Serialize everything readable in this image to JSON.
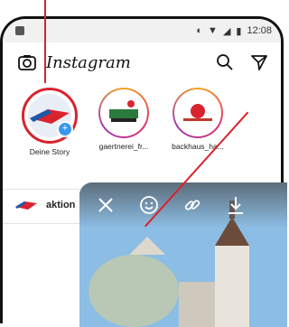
{
  "status_bar": {
    "time": "12:08"
  },
  "header": {
    "title": "Instagram"
  },
  "stories": [
    {
      "label": "Deine Story"
    },
    {
      "label": "gaertnerei_fr..."
    },
    {
      "label": "backhaus_ha..."
    }
  ],
  "feed": {
    "post_account": "aktion"
  },
  "colors": {
    "annotation_red": "#d9232d",
    "link_blue": "#3897f0"
  }
}
